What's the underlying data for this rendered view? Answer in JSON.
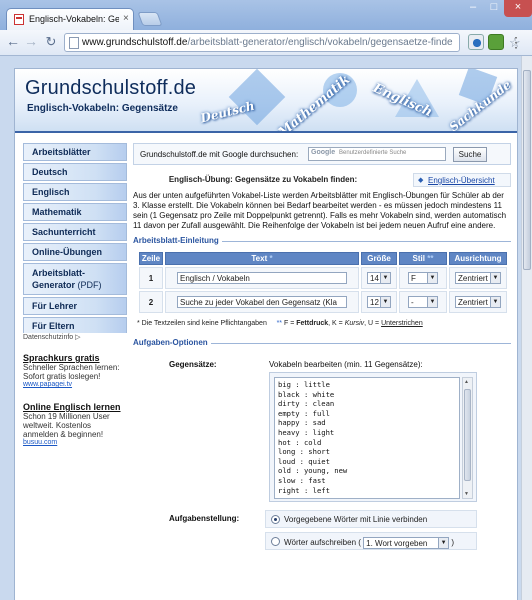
{
  "browser": {
    "tab_title": "Englisch-Vokabeln: Gegensätze",
    "tab_close": "×",
    "url_host": "www.grundschulstoff.de",
    "url_path": "/arbeitsblatt-generator/englisch/vokabeln/gegensaetze-finde",
    "nav_back": "←",
    "nav_forward": "→",
    "nav_reload": "↻",
    "star": "☆",
    "ext_menu": "⋮"
  },
  "header": {
    "site_title": "Grundschulstoff.de",
    "subtitle": "Englisch-Vokabeln: Gegensätze",
    "decor_words": [
      "Deutsch",
      "Mathematik",
      "Englisch",
      "Sachkunde"
    ]
  },
  "sidebar": {
    "items": [
      {
        "label": "Arbeitsblätter"
      },
      {
        "label": "Deutsch"
      },
      {
        "label": "Englisch"
      },
      {
        "label": "Mathematik"
      },
      {
        "label": "Sachunterricht"
      },
      {
        "label": "Online-Übungen"
      },
      {
        "label_line1": "Arbeitsblatt-",
        "label_line2": "Generator",
        "label_suffix": " (PDF)"
      },
      {
        "label": "Für Lehrer"
      },
      {
        "label": "Für Eltern"
      }
    ]
  },
  "ad": {
    "info": "Datenschutzinfo",
    "blocks": [
      {
        "heading": "Sprachkurs gratis",
        "text": "Schneller Sprachen lernen: Sofort gratis loslegen!",
        "link": "www.papagei.tv"
      },
      {
        "heading": "Online Englisch lernen",
        "text": "Schon 19 Millionen User weltweit. Kostenlos anmelden & beginnen!",
        "link": "busuu.com"
      }
    ]
  },
  "search": {
    "label": "Grundschulstoff.de mit Google durchsuchen:",
    "placeholder": "Benutzerdefinierte Suche",
    "button": "Suche"
  },
  "intro": {
    "title": "Englisch-Übung: Gegensätze zu Vokabeln finden:",
    "overview_link": "Englisch-Übersicht",
    "text": "Aus der unten aufgeführten Vokabel-Liste werden Arbeitsblätter mit Englisch-Übungen für Schüler ab der 3. Klasse erstellt. Die Vokabeln können bei Bedarf bearbeitet werden - es müssen jedoch mindestens 11 sein (1 Gegensatz pro Zeile mit Doppelpunkt getrennt). Falls es mehr Vokabeln sind, werden automatisch 11 davon per Zufall ausgewählt. Die Reihenfolge der Vokabeln ist bei jedem neuen Aufruf eine andere."
  },
  "einleitung": {
    "section_title": "Arbeitsblatt-Einleitung",
    "columns": {
      "zeile": "Zeile",
      "text": "Text",
      "text_mark": " *",
      "groesse": "Größe",
      "stil": "Stil",
      "stil_mark": " **",
      "ausrichtung": "Ausrichtung"
    },
    "rows": [
      {
        "num": "1",
        "text": "Englisch / Vokabeln",
        "size": "14",
        "style": "F",
        "align": "Zentriert"
      },
      {
        "num": "2",
        "text": "Suche zu jeder Vokabel den Gegensatz (Kla",
        "size": "12",
        "style": "-",
        "align": "Zentriert"
      }
    ],
    "legend": {
      "note": "* Die Textzeilen sind keine Pflichtangaben",
      "marks": "**",
      "f": " F = ",
      "f_word": "Fettdruck",
      "k": ",  K = ",
      "k_word": "Kursiv",
      "u": ",  U = ",
      "u_word": "Unterstrichen"
    }
  },
  "aufgaben": {
    "section_title": "Aufgaben-Optionen",
    "gegensaetze_label": "Gegensätze:",
    "vocab_hint": "Vokabeln bearbeiten (min. 11 Gegensätze):",
    "vocab_text": "big : little\nblack : white\ndirty : clean\nempty : full\nhappy : sad\nheavy : light\nhot : cold\nlong : short\nloud : quiet\nold : young, new\nslow : fast\nright : left",
    "aufgabenstellung_label": "Aufgabenstellung:",
    "option1": "Vorgegebene Wörter mit Linie verbinden",
    "option2": "Wörter aufschreiben (",
    "option2_select": "1. Wort vorgeben",
    "option2_end": ")"
  },
  "colors": {
    "accent": "#5f86c4",
    "title": "#0f2d5c",
    "section": "#2b55a0",
    "link": "#1a47a6"
  }
}
